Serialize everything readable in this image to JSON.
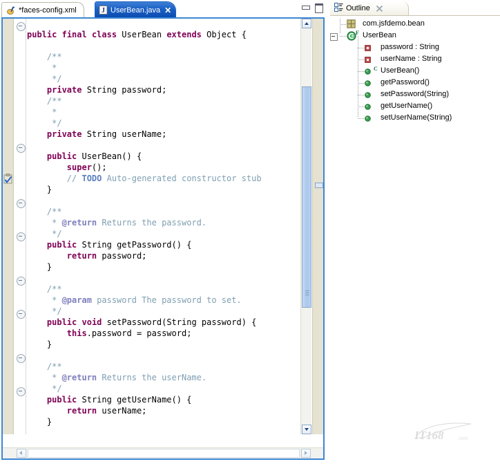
{
  "window": {
    "minimize_label": "Minimize",
    "maximize_label": "Maximize"
  },
  "editor": {
    "tabs": [
      {
        "label": "*faces-config.xml",
        "icon": "jsf-config-icon",
        "active": false,
        "dirty": true
      },
      {
        "label": "UserBean.java",
        "icon": "java-file-icon",
        "active": true,
        "dirty": false,
        "close_label": "✕"
      }
    ],
    "code_lines": [
      [
        {
          "t": "public",
          "c": "kw"
        },
        {
          "t": " ",
          "c": "pl"
        },
        {
          "t": "final",
          "c": "kw"
        },
        {
          "t": " ",
          "c": "pl"
        },
        {
          "t": "class",
          "c": "kw"
        },
        {
          "t": " UserBean ",
          "c": "pl"
        },
        {
          "t": "extends",
          "c": "kw"
        },
        {
          "t": " Object {",
          "c": "pl"
        }
      ],
      [],
      [
        {
          "t": "    /**",
          "c": "jd"
        }
      ],
      [
        {
          "t": "     *",
          "c": "jd"
        }
      ],
      [
        {
          "t": "     */",
          "c": "jd"
        }
      ],
      [
        {
          "t": "    ",
          "c": "pl"
        },
        {
          "t": "private",
          "c": "kw"
        },
        {
          "t": " String password;",
          "c": "pl"
        }
      ],
      [
        {
          "t": "    /**",
          "c": "jd"
        }
      ],
      [
        {
          "t": "     *",
          "c": "jd"
        }
      ],
      [
        {
          "t": "     */",
          "c": "jd"
        }
      ],
      [
        {
          "t": "    ",
          "c": "pl"
        },
        {
          "t": "private",
          "c": "kw"
        },
        {
          "t": " String userName;",
          "c": "pl"
        }
      ],
      [],
      [
        {
          "t": "    ",
          "c": "pl"
        },
        {
          "t": "public",
          "c": "kw"
        },
        {
          "t": " UserBean() {",
          "c": "pl"
        }
      ],
      [
        {
          "t": "        ",
          "c": "pl"
        },
        {
          "t": "super",
          "c": "kw"
        },
        {
          "t": "();",
          "c": "pl"
        }
      ],
      [
        {
          "t": "        ",
          "c": "pl"
        },
        {
          "t": "// ",
          "c": "cm"
        },
        {
          "t": "TODO",
          "c": "td"
        },
        {
          "t": " Auto-generated constructor stub",
          "c": "cm"
        }
      ],
      [
        {
          "t": "    }",
          "c": "pl"
        }
      ],
      [],
      [
        {
          "t": "    /**",
          "c": "jd"
        }
      ],
      [
        {
          "t": "     * ",
          "c": "jd"
        },
        {
          "t": "@return",
          "c": "jdt"
        },
        {
          "t": " Returns the password.",
          "c": "jd"
        }
      ],
      [
        {
          "t": "     */",
          "c": "jd"
        }
      ],
      [
        {
          "t": "    ",
          "c": "pl"
        },
        {
          "t": "public",
          "c": "kw"
        },
        {
          "t": " String getPassword() {",
          "c": "pl"
        }
      ],
      [
        {
          "t": "        ",
          "c": "pl"
        },
        {
          "t": "return",
          "c": "kw"
        },
        {
          "t": " password;",
          "c": "pl"
        }
      ],
      [
        {
          "t": "    }",
          "c": "pl"
        }
      ],
      [],
      [
        {
          "t": "    /**",
          "c": "jd"
        }
      ],
      [
        {
          "t": "     * ",
          "c": "jd"
        },
        {
          "t": "@param",
          "c": "jdt"
        },
        {
          "t": " password The password to set.",
          "c": "jd"
        }
      ],
      [
        {
          "t": "     */",
          "c": "jd"
        }
      ],
      [
        {
          "t": "    ",
          "c": "pl"
        },
        {
          "t": "public",
          "c": "kw"
        },
        {
          "t": " ",
          "c": "pl"
        },
        {
          "t": "void",
          "c": "kw"
        },
        {
          "t": " setPassword(String password) {",
          "c": "pl"
        }
      ],
      [
        {
          "t": "        ",
          "c": "pl"
        },
        {
          "t": "this",
          "c": "kw"
        },
        {
          "t": ".password = password;",
          "c": "pl"
        }
      ],
      [
        {
          "t": "    }",
          "c": "pl"
        }
      ],
      [],
      [
        {
          "t": "    /**",
          "c": "jd"
        }
      ],
      [
        {
          "t": "     * ",
          "c": "jd"
        },
        {
          "t": "@return",
          "c": "jdt"
        },
        {
          "t": " Returns the userName.",
          "c": "jd"
        }
      ],
      [
        {
          "t": "     */",
          "c": "jd"
        }
      ],
      [
        {
          "t": "    ",
          "c": "pl"
        },
        {
          "t": "public",
          "c": "kw"
        },
        {
          "t": " String getUserName() {",
          "c": "pl"
        }
      ],
      [
        {
          "t": "        ",
          "c": "pl"
        },
        {
          "t": "return",
          "c": "kw"
        },
        {
          "t": " userName;",
          "c": "pl"
        }
      ],
      [
        {
          "t": "    }",
          "c": "pl"
        }
      ]
    ],
    "fold_line_indices": [
      0,
      11,
      16,
      19,
      23,
      26,
      30,
      33
    ],
    "gutter_markers": [
      {
        "type": "task-marker-icon",
        "line": 13
      }
    ],
    "scroll": {
      "vertical_up_label": "▲",
      "vertical_down_label": "▼",
      "horizontal_left_label": "◀",
      "horizontal_right_label": "▶"
    }
  },
  "outline": {
    "tab_label": "Outline",
    "tab_icon": "outline-view-icon",
    "close_icon": "close-view-icon",
    "tree": [
      {
        "label": "com.jsfdemo.bean",
        "icon": "package-icon",
        "indent": 0,
        "badge": "",
        "expander": false
      },
      {
        "label": "UserBean",
        "icon": "class-icon",
        "indent": 0,
        "badge": "F",
        "expander": true
      },
      {
        "label": "password : String",
        "icon": "private-field-icon",
        "indent": 1,
        "badge": "",
        "expander": false
      },
      {
        "label": "userName : String",
        "icon": "private-field-icon",
        "indent": 1,
        "badge": "",
        "expander": false
      },
      {
        "label": "UserBean()",
        "icon": "public-method-icon",
        "indent": 1,
        "badge": "C",
        "expander": false
      },
      {
        "label": "getPassword()",
        "icon": "public-method-icon",
        "indent": 1,
        "badge": "",
        "expander": false
      },
      {
        "label": "setPassword(String)",
        "icon": "public-method-icon",
        "indent": 1,
        "badge": "",
        "expander": false
      },
      {
        "label": "getUserName()",
        "icon": "public-method-icon",
        "indent": 1,
        "badge": "",
        "expander": false
      },
      {
        "label": "setUserName(String)",
        "icon": "public-method-icon",
        "indent": 1,
        "badge": "",
        "expander": false
      }
    ]
  },
  "watermark": {
    "text": "IT168.com"
  },
  "colors": {
    "tab_active_bg": "#1a5fc4",
    "editor_border": "#3b87d4",
    "gutter_bg": "#e6e2d2",
    "keyword": "#7f0055",
    "comment": "#7f9fb2",
    "javadoc_tag": "#7f7fbf",
    "todo": "#5a7fbf",
    "outline_method": "#3aa050",
    "outline_field": "#c94f4f"
  }
}
